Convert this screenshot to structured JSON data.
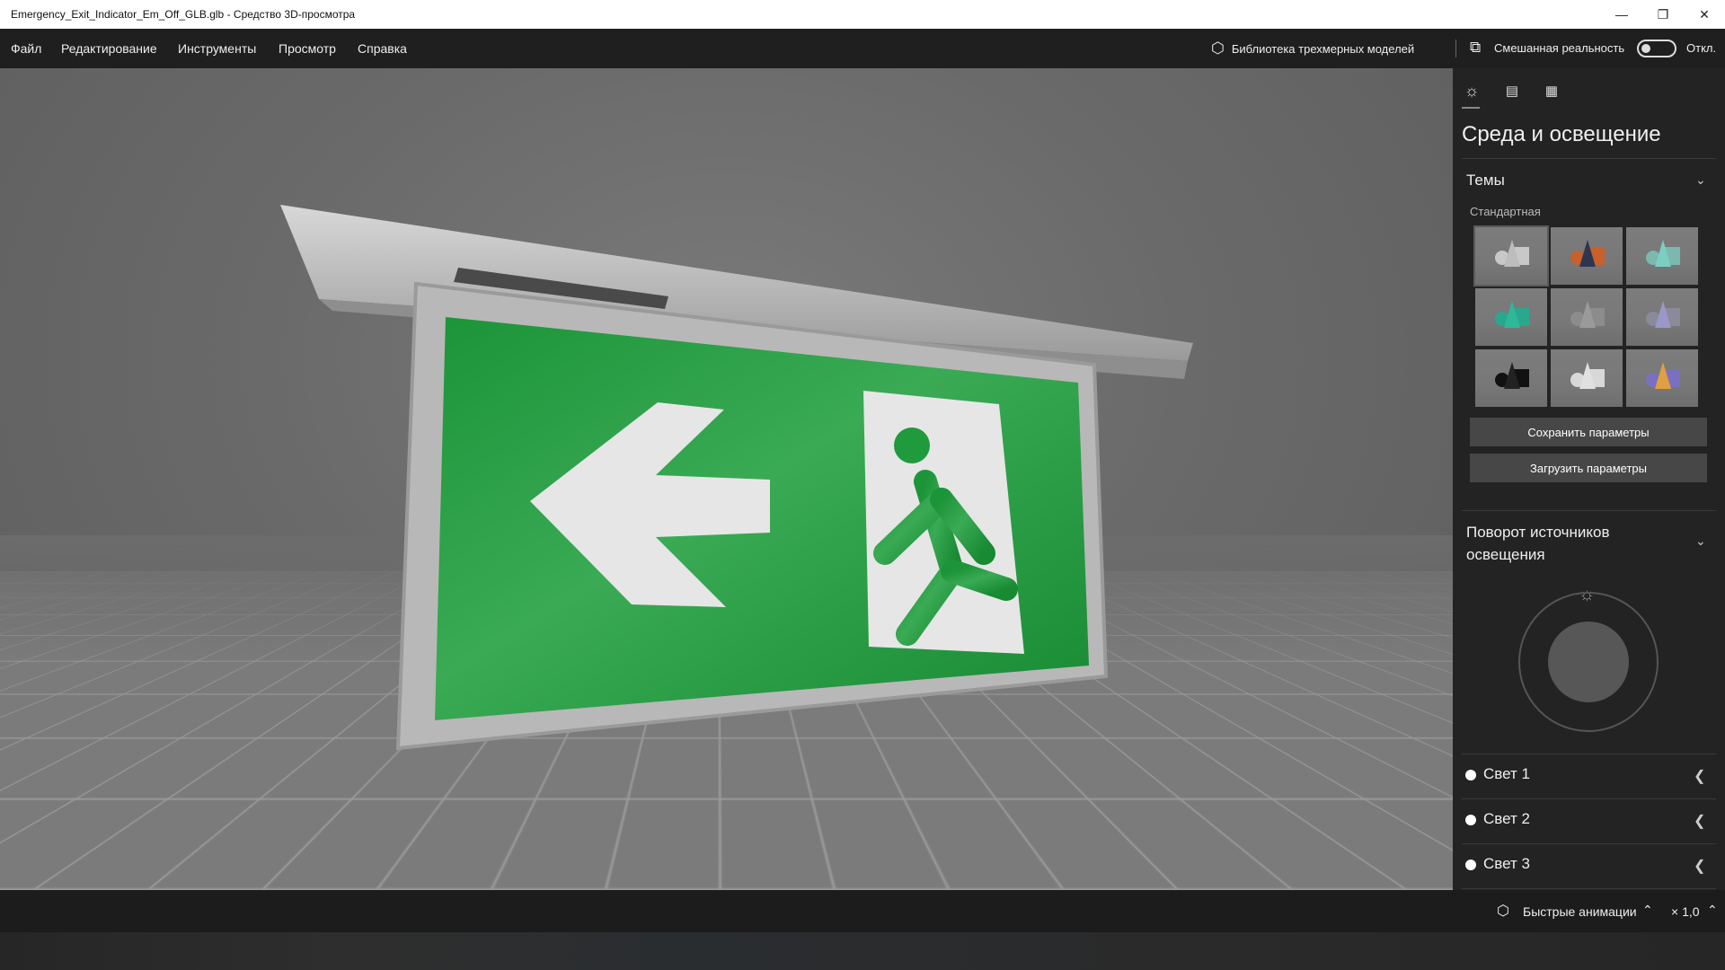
{
  "window": {
    "title": "Emergency_Exit_Indicator_Em_Off_GLB.glb - Средство 3D-просмотра"
  },
  "menu": {
    "items": [
      "Файл",
      "Редактирование",
      "Инструменты",
      "Просмотр",
      "Справка"
    ],
    "library": "Библиотека трехмерных моделей",
    "mixed_reality": "Смешанная реальность",
    "mixed_reality_state": "Откл."
  },
  "panel": {
    "title": "Среда и освещение",
    "themes": {
      "label": "Темы",
      "group": "Стандартная",
      "thumbnails": [
        {
          "cone": "#bdbdbd",
          "obj": "#c8c8c8"
        },
        {
          "cone": "#2e3550",
          "obj": "#c8602c"
        },
        {
          "cone": "#7ccfc0",
          "obj": "#7ab8b0"
        },
        {
          "cone": "#2fb898",
          "obj": "#2aa88e"
        },
        {
          "cone": "#9a9a9a",
          "obj": "#8c8c8c"
        },
        {
          "cone": "#9a98c8",
          "obj": "#8a8a9a"
        },
        {
          "cone": "#222222",
          "obj": "#111111"
        },
        {
          "cone": "#e0e0e0",
          "obj": "#d8d8d8"
        },
        {
          "cone": "#e0a040",
          "obj": "#7a70c0"
        }
      ],
      "save_label": "Сохранить параметры",
      "load_label": "Загрузить параметры"
    },
    "rotation": {
      "label": "Поворот источников освещения"
    },
    "lights": [
      "Свет 1",
      "Свет 2",
      "Свет 3"
    ]
  },
  "bottom": {
    "animations_label": "Быстрые анимации",
    "speed": "× 1,0"
  },
  "colors": {
    "sign_green": "#1f9a3c",
    "panel_bg": "#232323"
  }
}
